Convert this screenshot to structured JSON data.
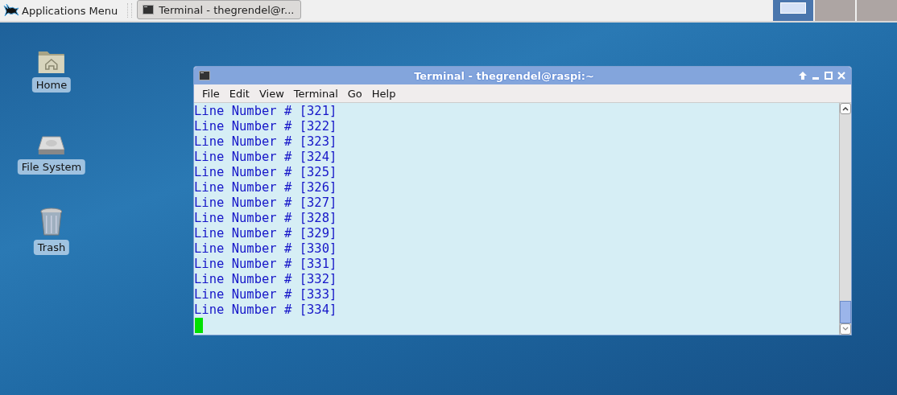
{
  "panel": {
    "app_menu": {
      "label": "Applications Menu"
    },
    "tasks": [
      {
        "label": "Terminal - thegrendel@r..."
      }
    ],
    "workspaces": [
      {
        "selected": true
      },
      {
        "selected": false
      },
      {
        "selected": false
      }
    ]
  },
  "desktop_icons": [
    {
      "kind": "home",
      "label": "Home"
    },
    {
      "kind": "drive",
      "label": "File System"
    },
    {
      "kind": "trash",
      "label": "Trash"
    }
  ],
  "terminal": {
    "title": "Terminal - thegrendel@raspi:~",
    "menu": [
      "File",
      "Edit",
      "View",
      "Terminal",
      "Go",
      "Help"
    ],
    "lines": [
      "Line Number # [321]",
      "Line Number # [322]",
      "Line Number # [323]",
      "Line Number # [324]",
      "Line Number # [325]",
      "Line Number # [326]",
      "Line Number # [327]",
      "Line Number # [328]",
      "Line Number # [329]",
      "Line Number # [330]",
      "Line Number # [331]",
      "Line Number # [332]",
      "Line Number # [333]",
      "Line Number # [334]"
    ]
  }
}
